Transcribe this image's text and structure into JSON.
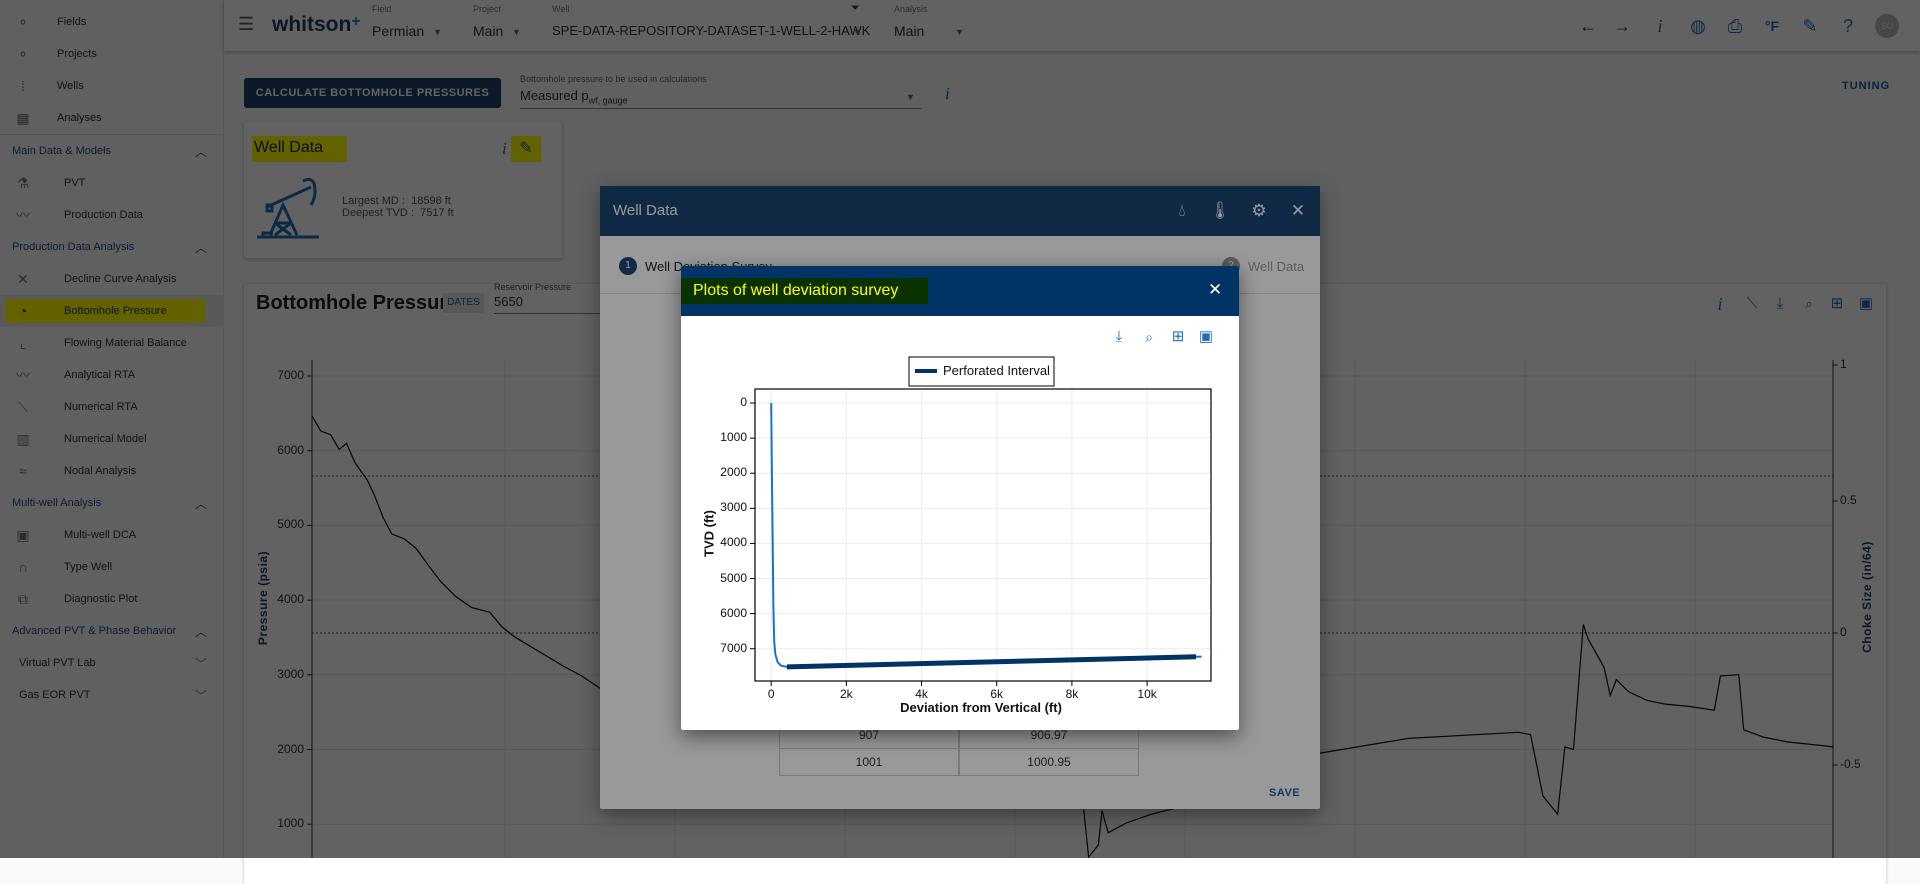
{
  "sidebar": {
    "top_items": [
      {
        "label": "Fields",
        "icon": "fields-icon"
      },
      {
        "label": "Projects",
        "icon": "projects-icon"
      },
      {
        "label": "Wells",
        "icon": "wells-icon"
      },
      {
        "label": "Analyses",
        "icon": "analyses-icon"
      }
    ],
    "sections": [
      {
        "title": "Main Data & Models",
        "items": [
          {
            "label": "PVT",
            "icon": "flask-icon"
          },
          {
            "label": "Production Data",
            "icon": "trend-icon"
          }
        ]
      },
      {
        "title": "Production Data Analysis",
        "items": [
          {
            "label": "Decline Curve Analysis",
            "icon": "dca-icon"
          },
          {
            "label": "Bottomhole Pressure",
            "icon": "gauge-icon",
            "active": true
          },
          {
            "label": "Flowing Material Balance",
            "icon": "fmb-icon"
          },
          {
            "label": "Analytical RTA",
            "icon": "trend-icon"
          },
          {
            "label": "Numerical RTA",
            "icon": "rta-icon"
          },
          {
            "label": "Numerical Model",
            "icon": "grid-model-icon"
          },
          {
            "label": "Nodal Analysis",
            "icon": "nodal-icon"
          }
        ]
      },
      {
        "title": "Multi-well Analysis",
        "items": [
          {
            "label": "Multi-well DCA",
            "icon": "tiles-icon"
          },
          {
            "label": "Type Well",
            "icon": "type-well-icon"
          },
          {
            "label": "Diagnostic Plot",
            "icon": "diagnostic-icon"
          }
        ]
      },
      {
        "title": "Advanced PVT & Phase Behavior",
        "items": []
      }
    ],
    "subsections": [
      {
        "title": "Virtual PVT Lab"
      },
      {
        "title": "Gas EOR PVT"
      }
    ]
  },
  "header": {
    "logo": "whitson",
    "field": {
      "label": "Field",
      "value": "Permian"
    },
    "project": {
      "label": "Project",
      "value": "Main"
    },
    "well": {
      "label": "Well",
      "value": "SPE-DATA-REPOSITORY-DATASET-1-WELL-2-HAWK"
    },
    "analysis": {
      "label": "Analysis",
      "value": "Main"
    },
    "temperature_unit": "°F",
    "avatar": "SU"
  },
  "toolbar": {
    "calculate_button": "CALCULATE BOTTOMHOLE PRESSURES",
    "bhp_select_label": "Bottomhole pressure to be used in calculations",
    "bhp_select_value": "Measured p",
    "bhp_select_sub": "wf, gauge",
    "tuning": "TUNING"
  },
  "well_card": {
    "title": "Well Data",
    "md_label": "Largest MD :",
    "md_value": "18598 ft",
    "tvd_label": "Deepest TVD :",
    "tvd_value": "7517 ft"
  },
  "bhp_card": {
    "title": "Bottomhole Pressure",
    "dates_badge": "DATES",
    "reservoir_label": "Reservoir Pressure",
    "reservoir_value": "5650",
    "ylabel": "Pressure (psia)",
    "y2label": "Choke Size (in/64)",
    "y_ticks": [
      "7000",
      "6000",
      "5000",
      "4000",
      "3000",
      "2000",
      "1000"
    ],
    "y2_ticks": [
      "1",
      "0.5",
      "0",
      "-0.5"
    ]
  },
  "well_dialog": {
    "title": "Well Data",
    "steps": [
      {
        "num": "1",
        "label": "Well Deviation Survey"
      },
      {
        "num": "2",
        "label": "Well Data"
      }
    ],
    "table_rows": [
      [
        "907",
        "906.97"
      ],
      [
        "1001",
        "1000.95"
      ]
    ],
    "save": "SAVE"
  },
  "plot_modal": {
    "title": "Plots of well deviation survey"
  },
  "colors": {
    "accent": "#003366",
    "survey_line": "#1a6fd6",
    "highlight": "#ffff00",
    "title_bg": "#0a3200"
  },
  "chart_data": {
    "type": "line",
    "xlabel": "Deviation from Vertical (ft)",
    "ylabel": "TVD (ft)",
    "xlim": [
      -430,
      11700
    ],
    "ylim": [
      7920,
      -400
    ],
    "y_inverted": true,
    "grid": true,
    "legend_placement": "top-center",
    "x_ticks": [
      {
        "v": 0,
        "label": "0"
      },
      {
        "v": 2000,
        "label": "2k"
      },
      {
        "v": 4000,
        "label": "4k"
      },
      {
        "v": 6000,
        "label": "6k"
      },
      {
        "v": 8000,
        "label": "8k"
      },
      {
        "v": 10000,
        "label": "10k"
      }
    ],
    "y_ticks": [
      {
        "v": 0,
        "label": "0"
      },
      {
        "v": 1000,
        "label": "1000"
      },
      {
        "v": 2000,
        "label": "2000"
      },
      {
        "v": 3000,
        "label": "3000"
      },
      {
        "v": 4000,
        "label": "4000"
      },
      {
        "v": 5000,
        "label": "5000"
      },
      {
        "v": 6000,
        "label": "6000"
      },
      {
        "v": 7000,
        "label": "7000"
      }
    ],
    "series": [
      {
        "points": [
          [
            0,
            0
          ],
          [
            15,
            1500
          ],
          [
            30,
            3000
          ],
          [
            45,
            4500
          ],
          [
            60,
            5800
          ],
          [
            80,
            6800
          ],
          [
            110,
            7150
          ],
          [
            170,
            7380
          ],
          [
            260,
            7480
          ],
          [
            420,
            7517
          ],
          [
            11300,
            7230
          ],
          [
            11450,
            7225
          ]
        ],
        "color": "#1a6fd6"
      },
      {
        "name": "Perforated Interval",
        "points": [
          [
            420,
            7517
          ],
          [
            11300,
            7230
          ]
        ],
        "color": "#003366"
      }
    ]
  }
}
